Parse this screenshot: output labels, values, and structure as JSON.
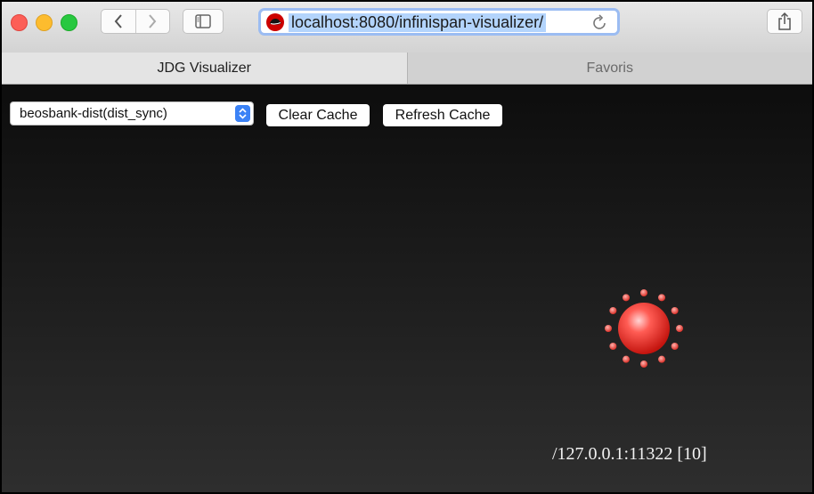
{
  "toolbar": {
    "url": "localhost:8080/infinispan-visualizer/"
  },
  "tabs": [
    {
      "label": "JDG Visualizer",
      "active": true
    },
    {
      "label": "Favoris",
      "active": false
    }
  ],
  "controls": {
    "cache_select_value": "beosbank-dist(dist_sync)",
    "clear_label": "Clear Cache",
    "refresh_label": "Refresh Cache"
  },
  "node": {
    "label": "/127.0.0.1:11322 [10]",
    "color": "#e8312a"
  },
  "icons": [
    "back-icon",
    "forward-icon",
    "sidebar-icon",
    "redhat-logo-icon",
    "reload-icon",
    "share-icon",
    "select-arrows-icon",
    "cache-node-icon"
  ]
}
